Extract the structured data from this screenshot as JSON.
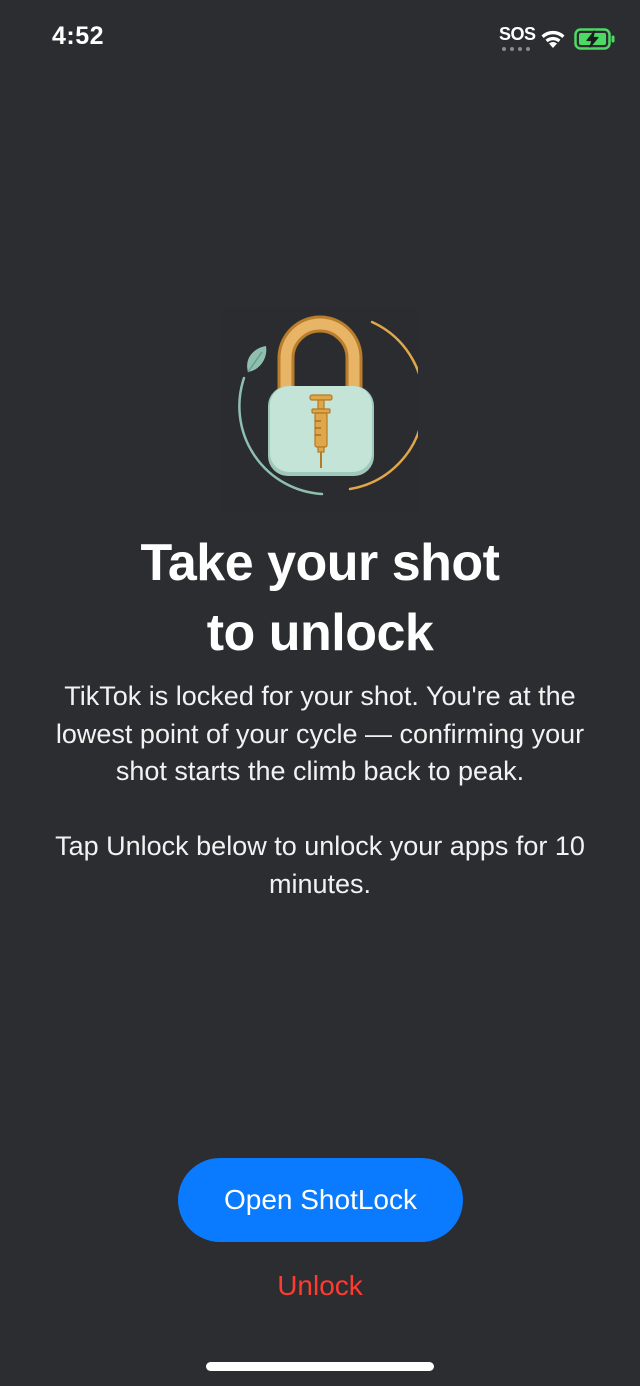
{
  "status_bar": {
    "time": "4:52",
    "carrier_status": "SOS",
    "icons": [
      "wifi-icon",
      "battery-charging-icon"
    ],
    "battery_color": "#4cd964"
  },
  "hero": {
    "icon": "lock-syringe-icon",
    "colors": {
      "shackle": "#e0a64a",
      "lock_body": "#b9ddd0",
      "syringe": "#d7962f",
      "leaf": "#8fbfae"
    }
  },
  "title": {
    "line1": "Take your shot",
    "line2": "to unlock"
  },
  "message": {
    "paragraph1": "TikTok is locked for your shot. You're at the lowest point of your cycle — confirming your shot starts the climb back to peak.",
    "paragraph2": "Tap Unlock below to unlock your apps for 10 minutes."
  },
  "actions": {
    "primary_label": "Open ShotLock",
    "secondary_label": "Unlock",
    "primary_color": "#0a7aff",
    "secondary_color": "#ff3b30"
  }
}
